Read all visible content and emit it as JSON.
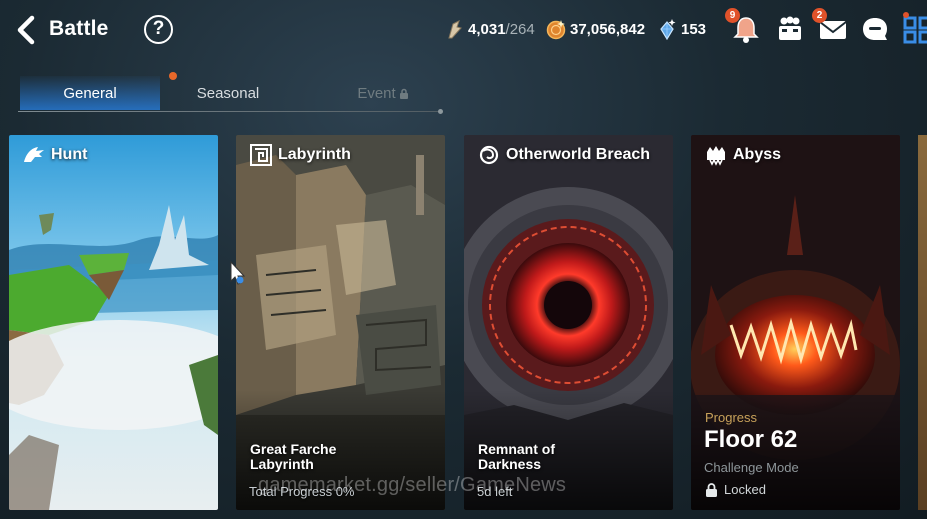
{
  "header": {
    "title": "Battle",
    "help_label": "?"
  },
  "currencies": {
    "stamina_current": "4,031",
    "stamina_max": "/264",
    "gold": "37,056,842",
    "gems": "153"
  },
  "notifications": {
    "bell_count": "9",
    "mail_count": "2"
  },
  "tabs": [
    {
      "label": "General",
      "active": true
    },
    {
      "label": "Seasonal",
      "active": false,
      "has_dot": true
    },
    {
      "label": "Event",
      "active": false,
      "locked": true
    }
  ],
  "cards": {
    "hunt": {
      "title": "Hunt"
    },
    "labyrinth": {
      "title": "Labyrinth",
      "subtitle": "Great Farche Labyrinth",
      "meta": "Total Progress 0%"
    },
    "otherworld": {
      "title": "Otherworld Breach",
      "subtitle": "Remnant of Darkness",
      "meta": "5d left"
    },
    "abyss": {
      "title": "Abyss",
      "progress_label": "Progress",
      "floor": "Floor 62",
      "mode": "Challenge Mode",
      "status": "Locked"
    }
  },
  "watermark": "gamemarket.gg/seller/GameNews",
  "icons": {
    "back": "back-arrow-icon",
    "help": "help-icon",
    "stamina": "stamina-icon",
    "gold": "gold-coin-icon",
    "gem": "gem-icon",
    "bell": "bell-icon",
    "guild": "guild-icon",
    "mail": "mail-icon",
    "chat": "chat-icon",
    "menu": "grid-menu-icon"
  },
  "colors": {
    "accent_blue": "#2f86e0",
    "badge_orange": "#e0522a",
    "progress_gold": "#c7a15a"
  }
}
